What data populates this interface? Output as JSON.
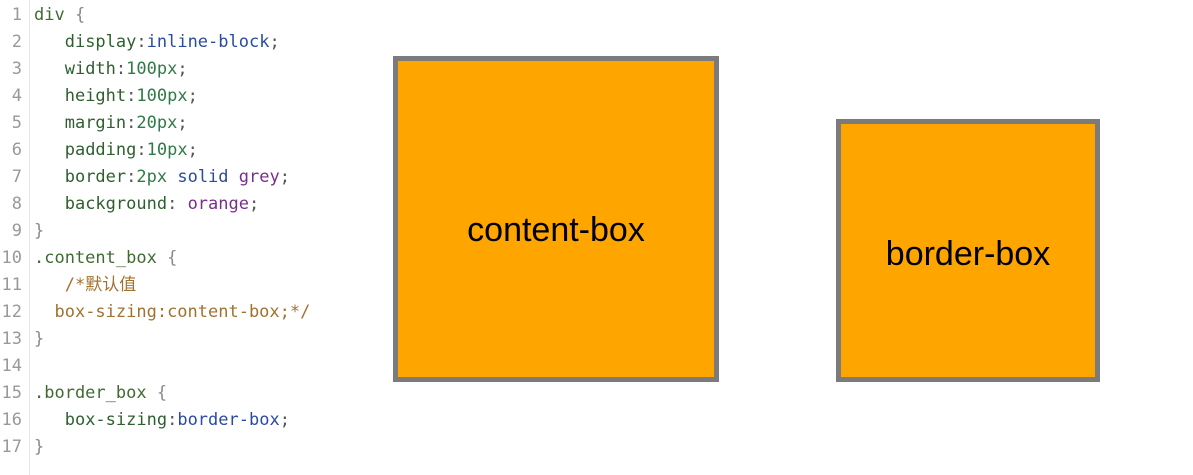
{
  "editor": {
    "line_numbers": [
      "1",
      "2",
      "3",
      "4",
      "5",
      "6",
      "7",
      "8",
      "9",
      "10",
      "11",
      "12",
      "13",
      "14",
      "15",
      "16",
      "17"
    ],
    "lines": [
      {
        "indent": "",
        "tokens": [
          {
            "t": "div ",
            "c": "sel"
          },
          {
            "t": "{",
            "c": "brace"
          }
        ]
      },
      {
        "indent": "   ",
        "tokens": [
          {
            "t": "display",
            "c": "prop"
          },
          {
            "t": ":",
            "c": "punc"
          },
          {
            "t": "inline-block",
            "c": "kw"
          },
          {
            "t": ";",
            "c": "punc"
          }
        ]
      },
      {
        "indent": "   ",
        "tokens": [
          {
            "t": "width",
            "c": "prop"
          },
          {
            "t": ":",
            "c": "punc"
          },
          {
            "t": "100px",
            "c": "num"
          },
          {
            "t": ";",
            "c": "punc"
          }
        ]
      },
      {
        "indent": "   ",
        "tokens": [
          {
            "t": "height",
            "c": "prop"
          },
          {
            "t": ":",
            "c": "punc"
          },
          {
            "t": "100px",
            "c": "num"
          },
          {
            "t": ";",
            "c": "punc"
          }
        ]
      },
      {
        "indent": "   ",
        "tokens": [
          {
            "t": "margin",
            "c": "prop"
          },
          {
            "t": ":",
            "c": "punc"
          },
          {
            "t": "20px",
            "c": "num"
          },
          {
            "t": ";",
            "c": "punc"
          }
        ]
      },
      {
        "indent": "   ",
        "tokens": [
          {
            "t": "padding",
            "c": "prop"
          },
          {
            "t": ":",
            "c": "punc"
          },
          {
            "t": "10px",
            "c": "num"
          },
          {
            "t": ";",
            "c": "punc"
          }
        ]
      },
      {
        "indent": "   ",
        "tokens": [
          {
            "t": "border",
            "c": "prop"
          },
          {
            "t": ":",
            "c": "punc"
          },
          {
            "t": "2px",
            "c": "num"
          },
          {
            "t": " solid ",
            "c": "kw"
          },
          {
            "t": "grey",
            "c": "str"
          },
          {
            "t": ";",
            "c": "punc"
          }
        ]
      },
      {
        "indent": "   ",
        "tokens": [
          {
            "t": "background",
            "c": "prop"
          },
          {
            "t": ": ",
            "c": "punc"
          },
          {
            "t": "orange",
            "c": "str"
          },
          {
            "t": ";",
            "c": "punc"
          }
        ]
      },
      {
        "indent": "",
        "tokens": [
          {
            "t": "}",
            "c": "brace"
          }
        ]
      },
      {
        "indent": "",
        "tokens": [
          {
            "t": ".content_box ",
            "c": "sel"
          },
          {
            "t": "{",
            "c": "brace"
          }
        ]
      },
      {
        "indent": "   ",
        "tokens": [
          {
            "t": "/*默认值",
            "c": "comment"
          }
        ]
      },
      {
        "indent": "  ",
        "tokens": [
          {
            "t": "box-sizing:content-box;*/",
            "c": "comment"
          }
        ]
      },
      {
        "indent": "",
        "tokens": [
          {
            "t": "}",
            "c": "brace"
          }
        ]
      },
      {
        "indent": "",
        "tokens": []
      },
      {
        "indent": "",
        "tokens": [
          {
            "t": ".border_box ",
            "c": "sel"
          },
          {
            "t": "{",
            "c": "brace"
          }
        ]
      },
      {
        "indent": "   ",
        "tokens": [
          {
            "t": "box-sizing",
            "c": "prop"
          },
          {
            "t": ":",
            "c": "punc"
          },
          {
            "t": "border-box",
            "c": "kw"
          },
          {
            "t": ";",
            "c": "punc"
          }
        ]
      },
      {
        "indent": "",
        "tokens": [
          {
            "t": "}",
            "c": "brace"
          }
        ]
      }
    ]
  },
  "preview": {
    "content_box_label": "content-box",
    "border_box_label": "border-box",
    "box_fill": "#ffa500",
    "box_border": "#7b7b7b"
  }
}
